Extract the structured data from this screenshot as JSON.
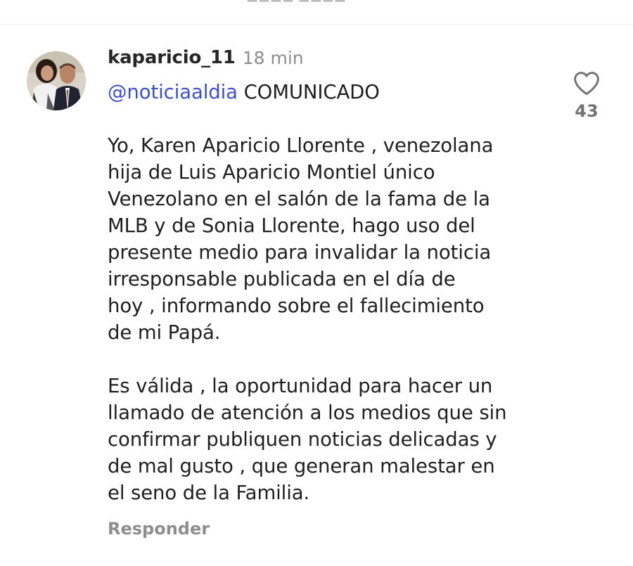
{
  "comment": {
    "username": "kaparicio_11",
    "timestamp": "18 min",
    "mention": "@noticiaaldia",
    "title": " COMUNICADO",
    "paragraph1": "Yo, Karen Aparicio Llorente , venezolana\nhija de Luis Aparicio Montiel único\nVenezolano en el salón de la fama de la\nMLB y de Sonia Llorente, hago uso del\npresente medio para invalidar la noticia\nirresponsable publicada en el día de\nhoy , informando sobre el fallecimiento\nde mi Papá.",
    "paragraph2": "Es válida , la oportunidad para hacer un\nllamado de atención a los medios que sin\nconfirmar publiquen noticias delicadas y\nde mal gusto , que generan malestar en\nel seno de la Familia.",
    "reply_label": "Responder",
    "like_count": "43",
    "like_icon": "heart-outline-icon"
  },
  "colors": {
    "mention": "#3b4fd6",
    "meta": "#8e8e8e"
  }
}
